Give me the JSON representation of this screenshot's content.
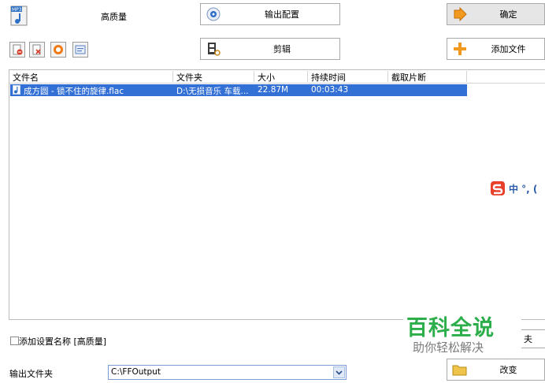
{
  "toolbar": {
    "quality_label": "高质量",
    "output_config_label": "输出配置",
    "ok_label": "确定",
    "cut_label": "剪辑",
    "add_file_label": "添加文件"
  },
  "file_list": {
    "columns": [
      "文件名",
      "文件夹",
      "大小",
      "持续时间",
      "截取片断"
    ],
    "rows": [
      {
        "name": "成方圆 - 锁不住的旋律.flac",
        "folder": "D:\\无损音乐 车载...",
        "size": "22.87M",
        "duration": "00:03:43",
        "clip": ""
      }
    ]
  },
  "ime_bar": {
    "text": "中 °, ("
  },
  "watermark": {
    "title": "百科全说",
    "subtitle": "助你轻松解决"
  },
  "footer": {
    "add_setting_name_label": "添加设置名称 [高质量]",
    "output_folder_label": "输出文件夹",
    "output_folder_value": "C:\\FFOutput",
    "change_label": "改变",
    "partial_label": "夫"
  }
}
